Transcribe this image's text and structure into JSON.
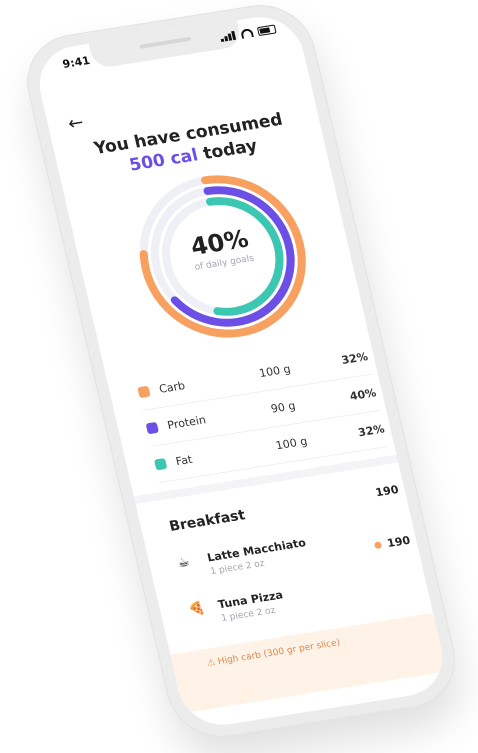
{
  "status": {
    "time": "9:41"
  },
  "header": {
    "title_line1": "You have consumed",
    "title_accent": "500 cal",
    "title_rest": "today"
  },
  "donut": {
    "percent": "40%",
    "subtitle": "of daily goals",
    "rings": [
      {
        "name": "Carb",
        "color": "#f7a060",
        "fraction": 0.78
      },
      {
        "name": "Protein",
        "color": "#6b4fe6",
        "fraction": 0.66
      },
      {
        "name": "Fat",
        "color": "#3cc7b2",
        "fraction": 0.55
      }
    ]
  },
  "macros": [
    {
      "name": "Carb",
      "grams": "100 g",
      "percent": "32%",
      "color": "#f7a060"
    },
    {
      "name": "Protein",
      "grams": "90 g",
      "percent": "40%",
      "color": "#6b4fe6"
    },
    {
      "name": "Fat",
      "grams": "100 g",
      "percent": "32%",
      "color": "#3cc7b2"
    }
  ],
  "meal": {
    "title": "Breakfast",
    "calories": "190",
    "items": [
      {
        "icon": "coffee-icon",
        "name": "Latte Macchiato",
        "serving": "1 piece 2 oz",
        "calories": "190"
      },
      {
        "icon": "pizza-icon",
        "name": "Tuna Pizza",
        "serving": "1 piece 2 oz",
        "calories": ""
      }
    ]
  },
  "warning": {
    "text": "High carb (300 gr per slice)"
  }
}
